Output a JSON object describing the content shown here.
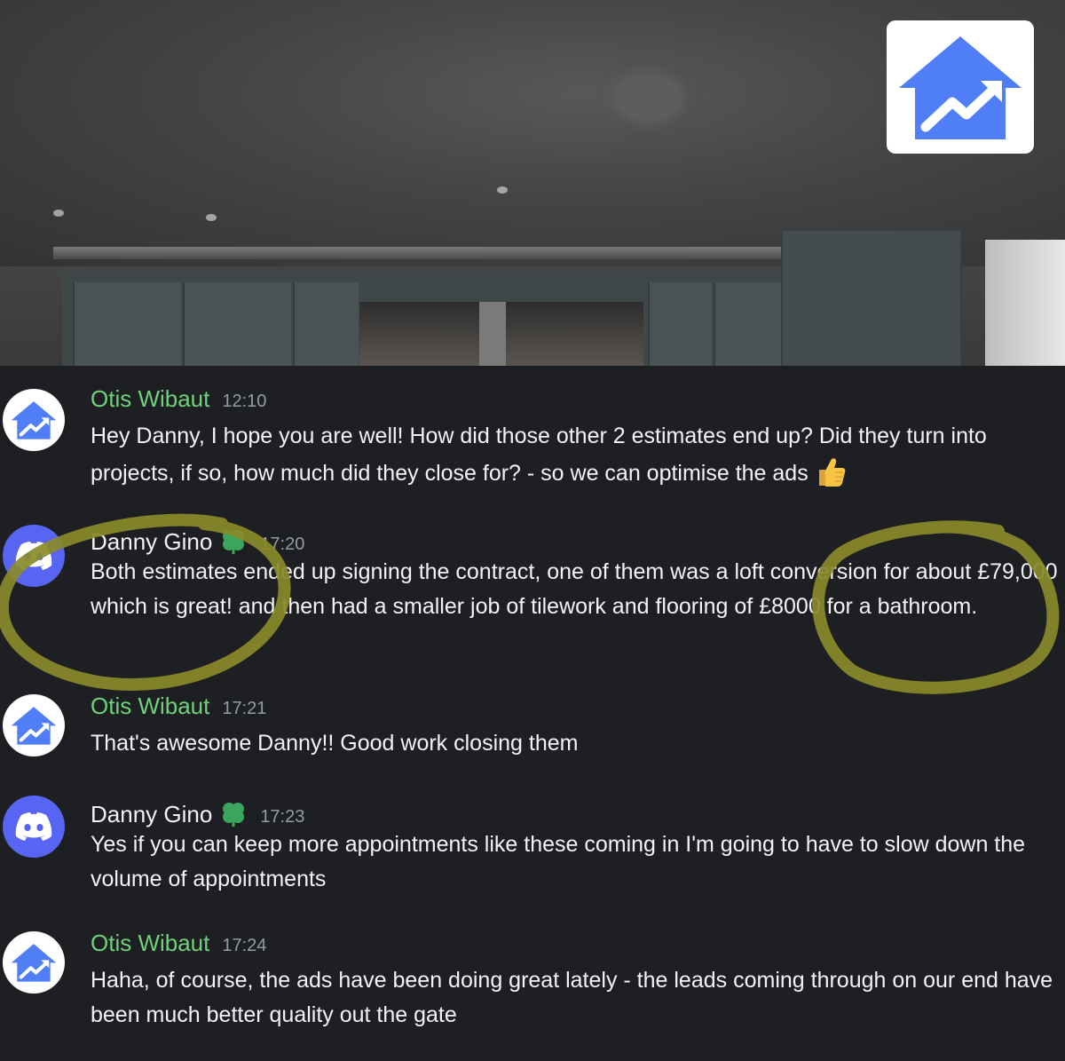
{
  "colors": {
    "background": "#1e1f22",
    "otis_name": "#6fd17a",
    "danny_name": "#f2f3f5",
    "discord_blurple": "#5865f2",
    "logo_blue": "#4f7ef7",
    "highlight_circle": "#8a8a2a"
  },
  "header": {
    "logo_icon": "house-growth-icon"
  },
  "messages": [
    {
      "author": "Otis Wibaut",
      "time": "12:10",
      "avatar_icon": "house-growth-icon",
      "text": "Hey Danny, I hope you are well! How did those other 2 estimates end up? Did they turn into projects, if so, how much did they close for? - so we can optimise the ads",
      "emoji": "thumbs-up-icon"
    },
    {
      "author": "Danny Gino",
      "time": "17:20",
      "avatar_icon": "discord-icon",
      "badge_icon": "clover-badge-icon",
      "text": "Both estimates ended up signing the contract, one of them was a loft conversion for about £79,000 which is great! and then had a smaller job of tilework and flooring of £8000 for a bathroom."
    },
    {
      "author": "Otis Wibaut",
      "time": "17:21",
      "avatar_icon": "house-growth-icon",
      "text": "That's awesome Danny!! Good work closing them"
    },
    {
      "author": "Danny Gino",
      "time": "17:23",
      "avatar_icon": "discord-icon",
      "badge_icon": "clover-badge-icon",
      "text": "Yes if you can keep more appointments like these coming in I'm going to have to slow down the volume of appointments"
    },
    {
      "author": "Otis Wibaut",
      "time": "17:24",
      "avatar_icon": "house-growth-icon",
      "text": "Haha, of course, the ads have been doing great lately - the leads coming through on our end have been much better quality out the gate"
    }
  ]
}
